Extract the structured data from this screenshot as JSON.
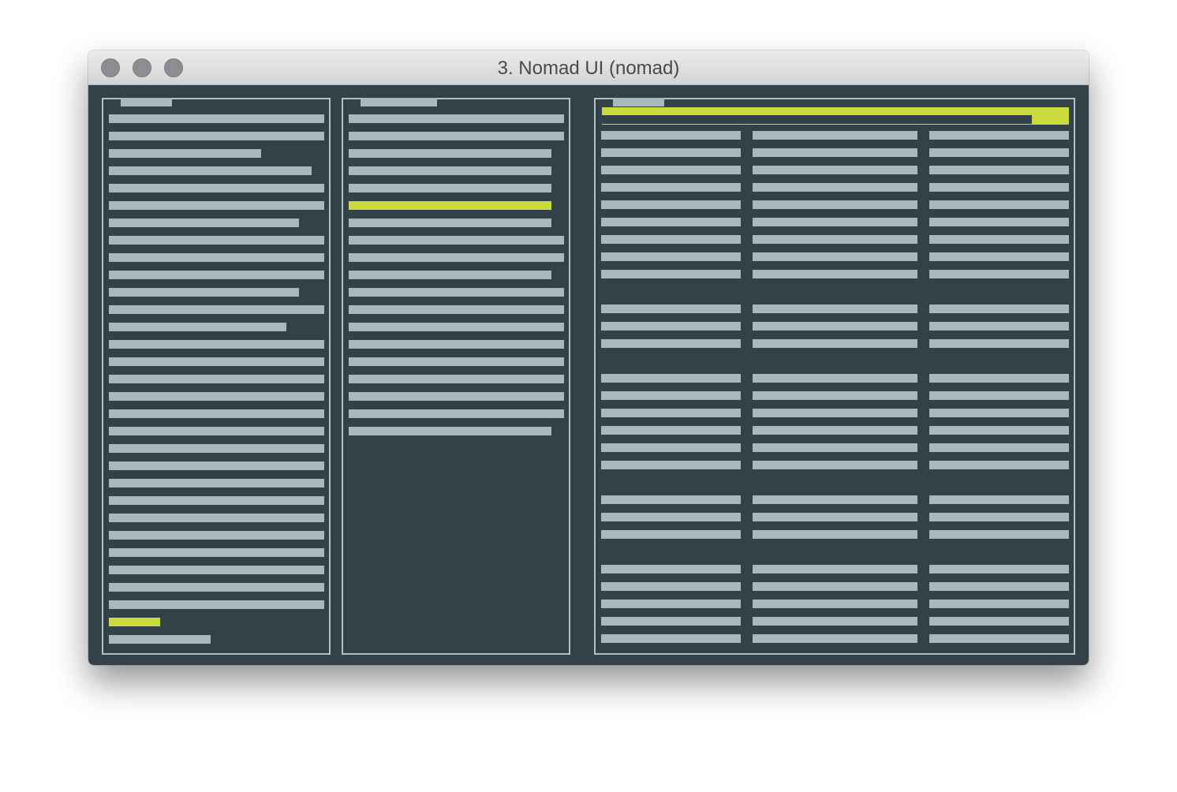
{
  "window": {
    "title": "3. Nomad UI (nomad)",
    "buttons": [
      "close-button",
      "minimize-button",
      "zoom-button"
    ]
  },
  "colors": {
    "background": "#334149",
    "text_block": "#aab7bd",
    "border": "#b3c1c6",
    "highlight": "#c9da3c"
  },
  "panes": {
    "left": {
      "selected_row": 30
    },
    "middle": {
      "selected_row": 6
    },
    "right": {
      "selected_row": 0,
      "column_count": 3
    }
  }
}
